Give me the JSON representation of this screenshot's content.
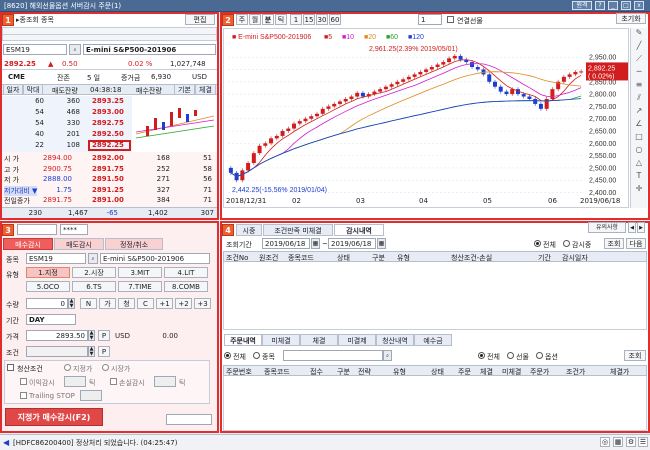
{
  "window": {
    "title": "[8620] 해외선물옵션 서버감시 주문(1)",
    "buttons": [
      "원격",
      "?",
      "_",
      "□",
      "x"
    ]
  },
  "left": {
    "header_title": "▸종조회 종목",
    "edit_label": "편집",
    "symbol": "ESM19",
    "symbol_name": "E-mini S&P500-201906",
    "price": "2892.25",
    "change_arrow": "▲",
    "change": "0.50",
    "change_rate": "0.02 %",
    "volume": "1,027,748",
    "exchange": "CME",
    "remain_label": "잔존",
    "remain_days": "5 일",
    "margin_label": "증거금",
    "margin": "6,930",
    "currency": "USD",
    "tabs": [
      "일자",
      "막대"
    ],
    "col_left": "매도잔량",
    "time": "04:38:18",
    "col_right": "매수잔량",
    "toggle1": "기본",
    "toggle2": "체결",
    "asks": [
      {
        "qty": "60",
        "vol": "360",
        "price": "2893.25"
      },
      {
        "qty": "54",
        "vol": "468",
        "price": "2893.00"
      },
      {
        "qty": "54",
        "vol": "330",
        "price": "2892.75"
      },
      {
        "qty": "40",
        "vol": "201",
        "price": "2892.50"
      },
      {
        "qty": "22",
        "vol": "108",
        "price": "2892.25"
      }
    ],
    "bids": [
      {
        "label": "시  가",
        "ref": "2894.00",
        "price": "2892.00",
        "vol": "168",
        "qty": "51"
      },
      {
        "label": "고  가",
        "ref": "2900.75",
        "price": "2891.75",
        "vol": "252",
        "qty": "58"
      },
      {
        "label": "저  가",
        "ref": "2888.00",
        "price": "2891.50",
        "vol": "271",
        "qty": "56"
      },
      {
        "label": "저가대비 ▼",
        "ref": "1.75",
        "price": "2891.25",
        "vol": "327",
        "qty": "71"
      },
      {
        "label": "전일종가",
        "ref": "2891.75",
        "price": "2891.00",
        "vol": "384",
        "qty": "71"
      }
    ],
    "total_ask_qty": "230",
    "total_ask_vol": "1,467",
    "net": "-65",
    "total_bid_vol": "1,402",
    "total_bid_qty": "307"
  },
  "chart_toolbar": {
    "periods": [
      "주",
      "월",
      "분",
      "틱"
    ],
    "intervals": [
      "1",
      "15",
      "30",
      "60"
    ],
    "combo": "1",
    "link_label": "연결선물",
    "reset": "초기화"
  },
  "chart_data": {
    "type": "candlestick",
    "title": "E-mini S&P500-201906",
    "legend": [
      {
        "name": "5",
        "color": "#d11d1d"
      },
      {
        "name": "10",
        "color": "#d11dd1"
      },
      {
        "name": "20",
        "color": "#e08a1d"
      },
      {
        "name": "60",
        "color": "#2aa52a"
      },
      {
        "name": "120",
        "color": "#1d3fd1"
      }
    ],
    "yaxis_ticks": [
      "2,950.00",
      "2,900.00",
      "2,850.00",
      "2,800.00",
      "2,750.00",
      "2,700.00",
      "2,650.00",
      "2,600.00",
      "2,550.00",
      "2,500.00",
      "2,450.00",
      "2,400.00"
    ],
    "ylim": [
      2390,
      2975
    ],
    "xaxis_ticks": [
      "2018/12/31",
      "02",
      "03",
      "04",
      "05",
      "06",
      "2019/06/18"
    ],
    "high_annotation": "2,961.25(2.39% 2019/05/01)",
    "low_annotation": "2,442.25(-15.56% 2019/01/04)",
    "last_price": "2,892.25",
    "last_change": "( 0.02%)",
    "closes": [
      2480,
      2450,
      2490,
      2520,
      2560,
      2590,
      2600,
      2620,
      2630,
      2650,
      2660,
      2680,
      2690,
      2700,
      2710,
      2720,
      2740,
      2750,
      2760,
      2770,
      2780,
      2790,
      2805,
      2790,
      2800,
      2810,
      2820,
      2830,
      2840,
      2850,
      2860,
      2870,
      2880,
      2890,
      2900,
      2910,
      2920,
      2930,
      2945,
      2955,
      2940,
      2930,
      2910,
      2900,
      2880,
      2850,
      2830,
      2810,
      2800,
      2820,
      2800,
      2790,
      2780,
      2760,
      2740,
      2780,
      2820,
      2850,
      2870,
      2880,
      2890,
      2892
    ]
  },
  "order_panel": {
    "account": "",
    "password": "****",
    "tabs": [
      "매수감시",
      "매도감시",
      "정정/취소"
    ],
    "symbol_label": "종목",
    "symbol": "ESM19",
    "symbol_name": "E-mini S&P500-201906",
    "type_label": "유형",
    "types": [
      "1.지정",
      "2.시장",
      "3.MIT",
      "4.LIT",
      "5.OCO",
      "6.TS",
      "7.TIME",
      "8.COMB"
    ],
    "qty_label": "수량",
    "qty": "0",
    "qty_btns": [
      "N",
      "가",
      "청",
      "C",
      "+1",
      "+2",
      "+3"
    ],
    "period_label": "기간",
    "period": "DAY",
    "price_label": "가격",
    "price": "2893.50",
    "price_btn": "P",
    "currency": "USD",
    "amount": "0.00",
    "cond_label": "조건",
    "cond_btn": "P",
    "liq_label": "청산조건",
    "opt1": "지정가",
    "opt2": "시장가",
    "profit_label": "이익감시",
    "tick": "틱",
    "loss_label": "손실감시",
    "trailing_label": "Trailing STOP",
    "submit": "지정가 매수감시(F2)"
  },
  "monitor": {
    "tabs": [
      "시중",
      "조건만족 미체결",
      "감시내역"
    ],
    "active": "감시내역",
    "caution": "유의사항",
    "period_label": "조회기간",
    "from": "2019/06/18",
    "to": "2019/06/18",
    "filter1": "전체",
    "filter2": "감시중",
    "btn_query": "조회",
    "btn_next": "다음",
    "columns": [
      "조건No",
      "원조건",
      "종목코드",
      "상태",
      "구분",
      "유형",
      "청산조건-손실",
      "기간",
      "감시일자"
    ]
  },
  "orders": {
    "tabs": [
      "주문내역",
      "미체결",
      "체결",
      "미결제",
      "청산내역",
      "예수금"
    ],
    "radio_a": [
      "전체",
      "종목"
    ],
    "radio_b": [
      "전체",
      "선물",
      "옵션"
    ],
    "btn_query": "조회",
    "columns": [
      "주문번호",
      "종목코드",
      "접수",
      "구분",
      "전략",
      "유형",
      "상태",
      "주문",
      "체결",
      "미체결",
      "주문가",
      "조건가",
      "체결가"
    ]
  },
  "status": {
    "message": "[HDFC86200400] 정상처리 되었습니다. (04:25:47)"
  }
}
